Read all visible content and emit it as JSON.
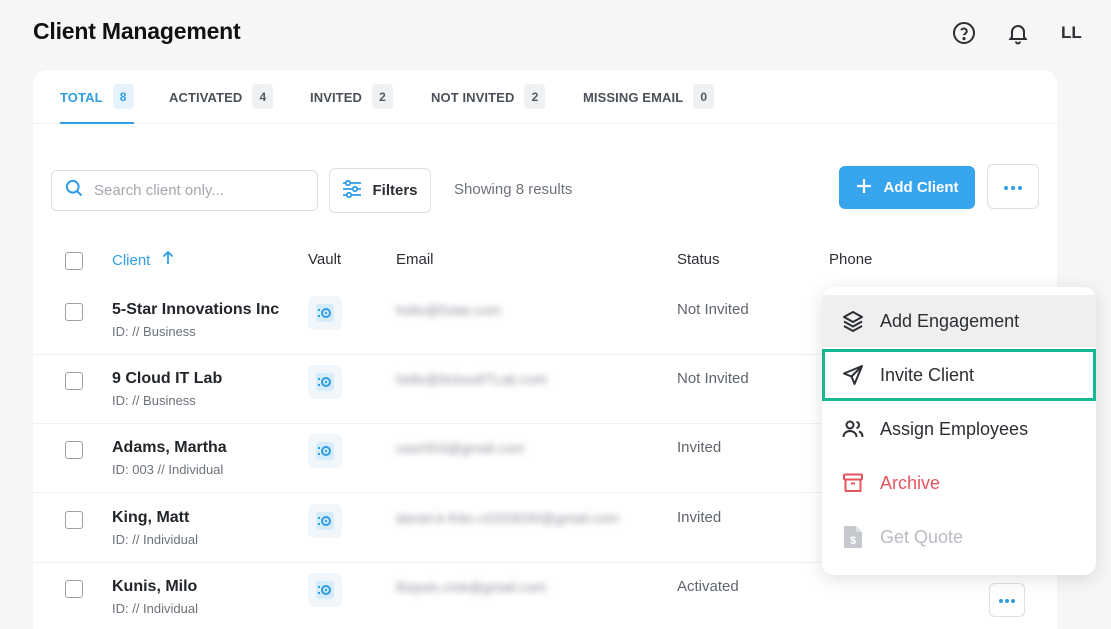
{
  "page": {
    "title": "Client Management"
  },
  "header": {
    "user_initials": "LL"
  },
  "tabs": [
    {
      "label": "TOTAL",
      "count": "8"
    },
    {
      "label": "ACTIVATED",
      "count": "4"
    },
    {
      "label": "INVITED",
      "count": "2"
    },
    {
      "label": "NOT INVITED",
      "count": "2"
    },
    {
      "label": "MISSING EMAIL",
      "count": "0"
    }
  ],
  "toolbar": {
    "search_placeholder": "Search client only...",
    "filters_label": "Filters",
    "results_text": "Showing 8 results",
    "add_client_label": "Add Client"
  },
  "table": {
    "columns": {
      "client": "Client",
      "vault": "Vault",
      "email": "Email",
      "status": "Status",
      "phone": "Phone"
    },
    "rows": [
      {
        "name": "5-Star Innovations Inc",
        "sub": "ID: // Business",
        "email": "hello@5star.com",
        "status": "Not Invited"
      },
      {
        "name": "9 Cloud IT Lab",
        "sub": "ID: // Business",
        "email": "hello@9cloudITLab.com",
        "status": "Not Invited"
      },
      {
        "name": "Adams, Martha",
        "sub": "ID: 003 // Individual",
        "email": "user003@gmail.com",
        "status": "Invited"
      },
      {
        "name": "King, Matt",
        "sub": "ID: // Individual",
        "email": "daniel.k-fnkc-c0203030@gmail.com",
        "status": "Invited"
      },
      {
        "name": "Kunis, Milo",
        "sub": "ID: // Individual",
        "email": "filzpols.cmk@gmail.com",
        "status": "Activated"
      }
    ]
  },
  "context_menu": {
    "items": [
      {
        "label": "Add Engagement",
        "icon": "layers-icon"
      },
      {
        "label": "Invite Client",
        "icon": "send-icon"
      },
      {
        "label": "Assign Employees",
        "icon": "users-icon"
      },
      {
        "label": "Archive",
        "icon": "archive-icon"
      },
      {
        "label": "Get Quote",
        "icon": "quote-document-icon"
      }
    ]
  },
  "colors": {
    "accent": "#2f9ee4",
    "button": "#36a5ee",
    "danger": "#e5555e",
    "highlight": "#14b892"
  }
}
